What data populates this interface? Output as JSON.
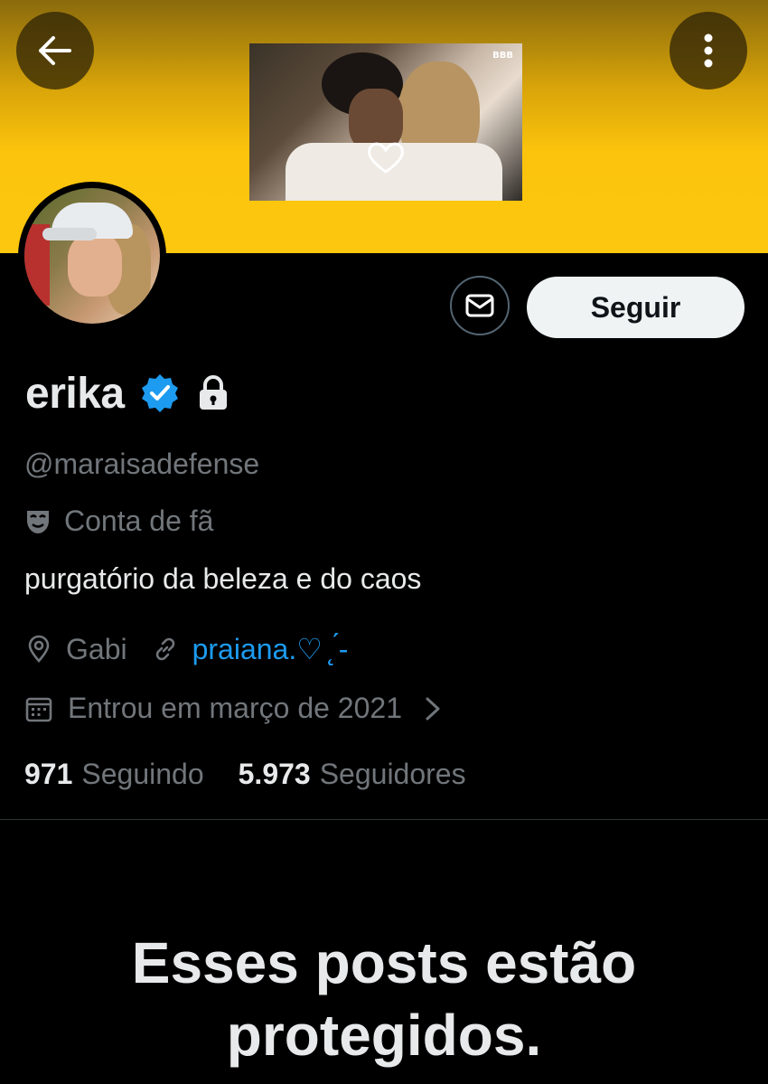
{
  "colors": {
    "banner": "#fcc40c",
    "background": "#000000",
    "text_primary": "#e7e9ea",
    "text_secondary": "#71767b",
    "link": "#1d9bf0",
    "verified": "#1d9bf0"
  },
  "header": {
    "back_icon": "arrow-left-icon",
    "more_icon": "more-vertical-icon",
    "banner_logo": "BBB"
  },
  "actions": {
    "dm_icon": "mail-icon",
    "follow_label": "Seguir"
  },
  "profile": {
    "name": "erika",
    "verified_icon": "verified-badge-icon",
    "protected_icon": "lock-icon",
    "handle": "@maraisadefense",
    "category": "Conta de fã",
    "bio": "purgatório da beleza e do caos",
    "location": "Gabi",
    "website": "praiana.♡ ̨ ́-",
    "joined": "Entrou em março de 2021"
  },
  "stats": {
    "following_count": "971",
    "following_label": "Seguindo",
    "followers_count": "5.973",
    "followers_label": "Seguidores"
  },
  "protected_message": {
    "line1": "Esses posts estão",
    "line2": "protegidos."
  }
}
